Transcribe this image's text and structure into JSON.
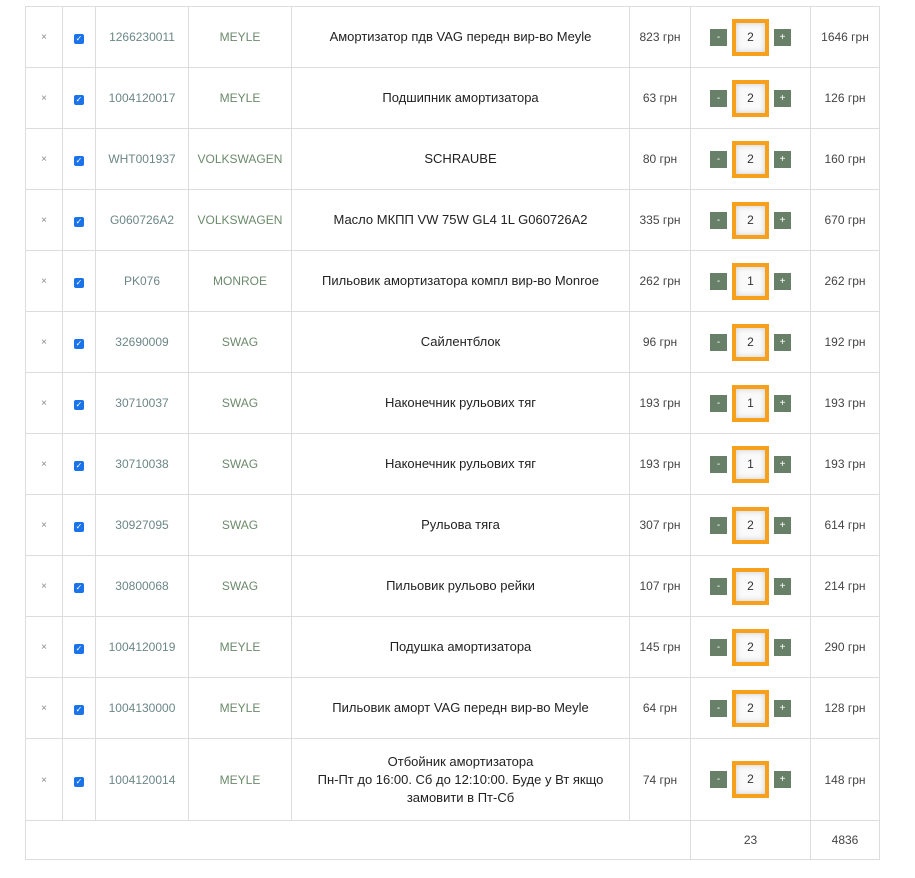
{
  "currency": "грн",
  "remove_icon": "×",
  "minus_label": "-",
  "plus_label": "+",
  "items": [
    {
      "code": "1266230011",
      "brand": "MEYLE",
      "name": "Амортизатор пдв VAG передн вир-во Meyle",
      "price": "823 грн",
      "qty": "2",
      "sum": "1646 грн"
    },
    {
      "code": "1004120017",
      "brand": "MEYLE",
      "name": "Подшипник амортизатора",
      "price": "63 грн",
      "qty": "2",
      "sum": "126 грн"
    },
    {
      "code": "WHT001937",
      "brand": "VOLKSWAGEN",
      "name": "SCHRAUBE",
      "price": "80 грн",
      "qty": "2",
      "sum": "160 грн"
    },
    {
      "code": "G060726A2",
      "brand": "VOLKSWAGEN",
      "name": "Масло МКПП VW 75W GL4 1L G060726A2",
      "price": "335 грн",
      "qty": "2",
      "sum": "670 грн"
    },
    {
      "code": "PK076",
      "brand": "MONROE",
      "name": "Пильовик амортизатора компл вир-во Monroe",
      "price": "262 грн",
      "qty": "1",
      "sum": "262 грн"
    },
    {
      "code": "32690009",
      "brand": "SWAG",
      "name": "Сайлентблок",
      "price": "96 грн",
      "qty": "2",
      "sum": "192 грн"
    },
    {
      "code": "30710037",
      "brand": "SWAG",
      "name": "Наконечник рульових тяг",
      "price": "193 грн",
      "qty": "1",
      "sum": "193 грн"
    },
    {
      "code": "30710038",
      "brand": "SWAG",
      "name": "Наконечник рульових тяг",
      "price": "193 грн",
      "qty": "1",
      "sum": "193 грн"
    },
    {
      "code": "30927095",
      "brand": "SWAG",
      "name": "Рульова тяга",
      "price": "307 грн",
      "qty": "2",
      "sum": "614 грн"
    },
    {
      "code": "30800068",
      "brand": "SWAG",
      "name": "Пильовик рульово рейки",
      "price": "107 грн",
      "qty": "2",
      "sum": "214 грн"
    },
    {
      "code": "1004120019",
      "brand": "MEYLE",
      "name": "Подушка амортизатора",
      "price": "145 грн",
      "qty": "2",
      "sum": "290 грн"
    },
    {
      "code": "1004130000",
      "brand": "MEYLE",
      "name": "Пильовик аморт VAG передн вир-во Meyle",
      "price": "64 грн",
      "qty": "2",
      "sum": "128 грн"
    },
    {
      "code": "1004120014",
      "brand": "MEYLE",
      "name": "Отбойник амортизатора",
      "note": "Пн-Пт до 16:00. Сб до 12:10:00. Буде у Вт якщо замовити в Пт-Сб",
      "price": "74 грн",
      "qty": "2",
      "sum": "148 грн"
    }
  ],
  "totals": {
    "qty": "23",
    "sum": "4836"
  }
}
